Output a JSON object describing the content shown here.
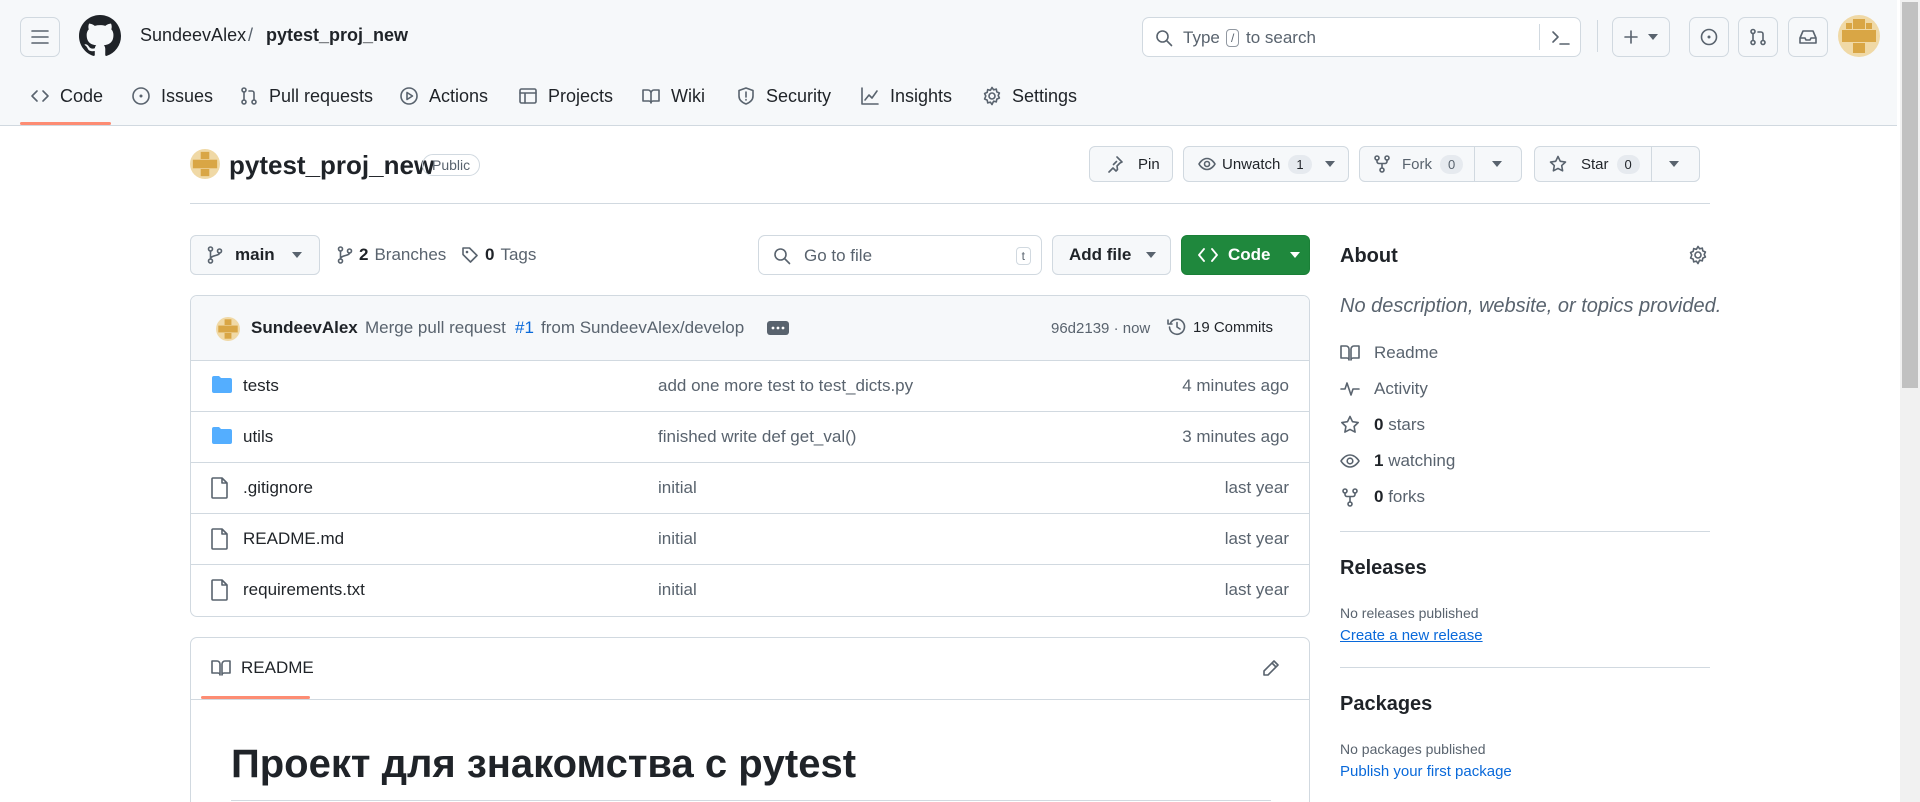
{
  "header": {
    "owner": "SundeevAlex",
    "slash": "/",
    "repo": "pytest_proj_new",
    "search_placeholder_prefix": "Type",
    "search_key": "/",
    "search_placeholder_suffix": "to search"
  },
  "tabs": [
    {
      "label": "Code",
      "icon": "code-icon",
      "active": true
    },
    {
      "label": "Issues",
      "icon": "issue-icon"
    },
    {
      "label": "Pull requests",
      "icon": "pull-request-icon"
    },
    {
      "label": "Actions",
      "icon": "play-icon"
    },
    {
      "label": "Projects",
      "icon": "table-icon"
    },
    {
      "label": "Wiki",
      "icon": "book-icon"
    },
    {
      "label": "Security",
      "icon": "shield-icon"
    },
    {
      "label": "Insights",
      "icon": "graph-icon"
    },
    {
      "label": "Settings",
      "icon": "gear-icon"
    }
  ],
  "repo": {
    "name": "pytest_proj_new",
    "visibility": "Public",
    "pin_label": "Pin",
    "unwatch_label": "Unwatch",
    "watch_count": "1",
    "fork_label": "Fork",
    "fork_count": "0",
    "star_label": "Star",
    "star_count": "0"
  },
  "toolbar": {
    "branch": "main",
    "branches_count": "2",
    "branches_label": "Branches",
    "tags_count": "0",
    "tags_label": "Tags",
    "goto_placeholder": "Go to file",
    "goto_key": "t",
    "add_file_label": "Add file",
    "code_label": "Code"
  },
  "commit": {
    "author": "SundeevAlex",
    "message_prefix": "Merge pull request",
    "pr_link": "#1",
    "message_suffix": "from SundeevAlex/develop",
    "hash_time": "96d2139 · now",
    "commits_label": "19 Commits"
  },
  "files": [
    {
      "name": "tests",
      "type": "folder",
      "message": "add one more test to test_dicts.py",
      "time": "4 minutes ago"
    },
    {
      "name": "utils",
      "type": "folder",
      "message": "finished write def get_val()",
      "time": "3 minutes ago"
    },
    {
      "name": ".gitignore",
      "type": "file",
      "message": "initial",
      "time": "last year"
    },
    {
      "name": "README.md",
      "type": "file",
      "message": "initial",
      "time": "last year"
    },
    {
      "name": "requirements.txt",
      "type": "file",
      "message": "initial",
      "time": "last year"
    }
  ],
  "readme": {
    "tab_label": "README",
    "heading": "Проект для знакомства с pytest"
  },
  "about": {
    "title": "About",
    "description": "No description, website, or topics provided.",
    "readme": "Readme",
    "activity": "Activity",
    "stars_count": "0",
    "stars_label": "stars",
    "watching_count": "1",
    "watching_label": "watching",
    "forks_count": "0",
    "forks_label": "forks"
  },
  "releases": {
    "title": "Releases",
    "none": "No releases published",
    "create_link": "Create a new release"
  },
  "packages": {
    "title": "Packages",
    "none": "No packages published",
    "publish_link": "Publish your first package"
  },
  "colors": {
    "accent_green": "#1f883d",
    "link_blue": "#0969da",
    "tab_underline": "#fd8c73",
    "folder_blue": "#54aeff"
  }
}
